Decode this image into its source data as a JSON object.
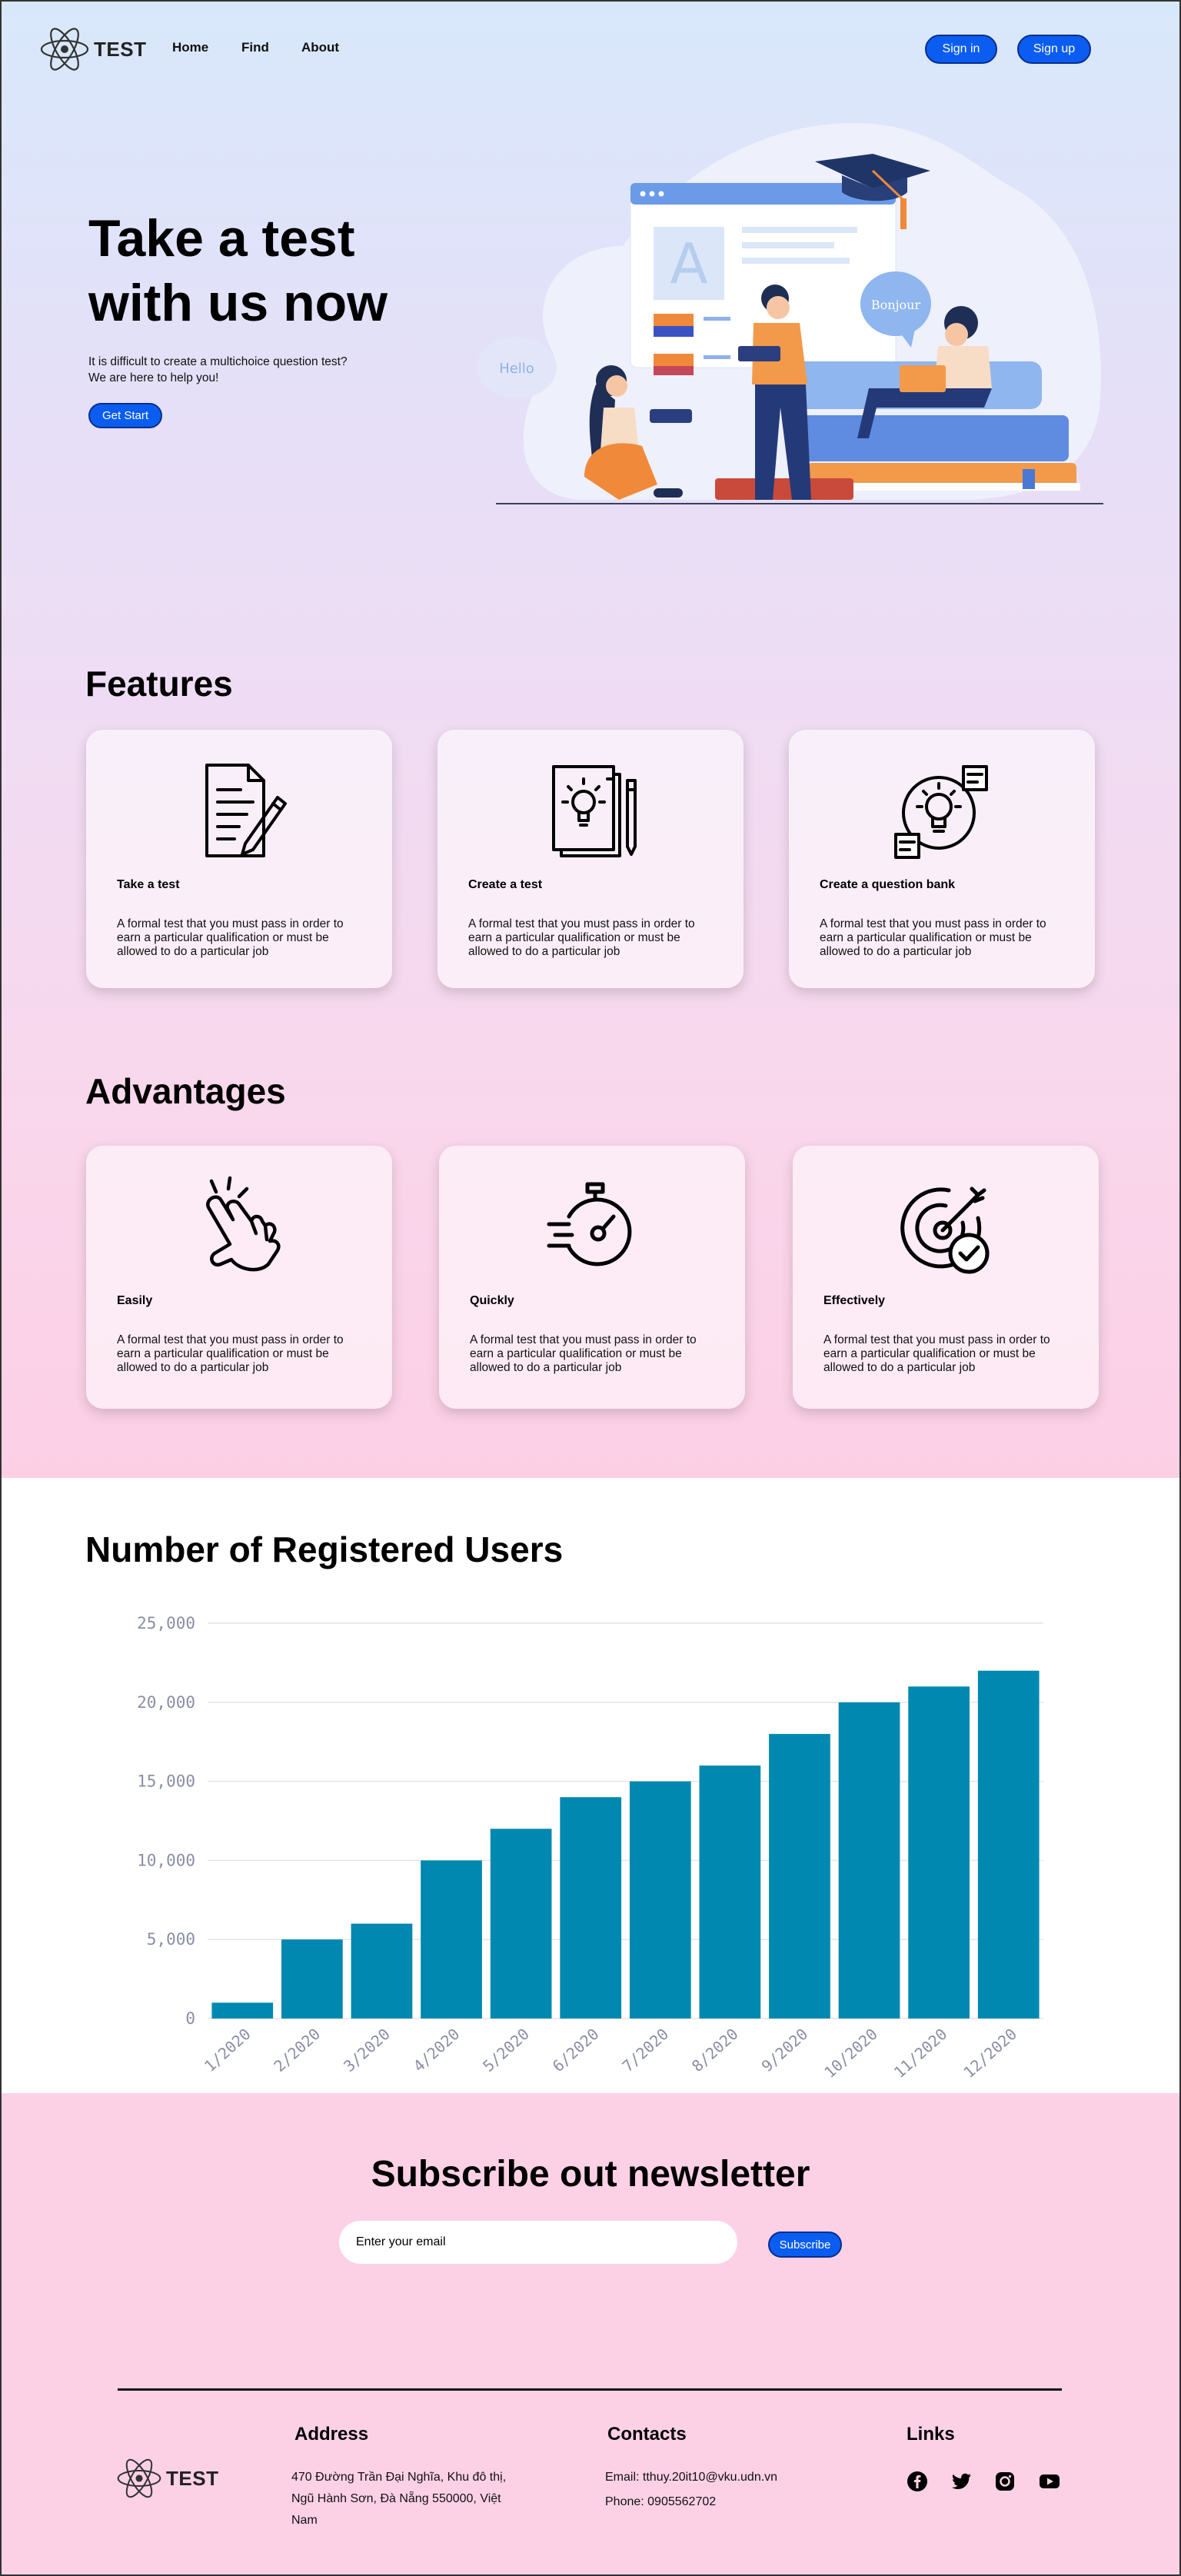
{
  "nav": {
    "brand": "TEST",
    "links": [
      "Home",
      "Find",
      "About"
    ],
    "sign_in": "Sign in",
    "sign_up": "Sign up"
  },
  "hero": {
    "title_line1": "Take a test",
    "title_line2": "with us now",
    "subtitle": "It is difficult to create a multichoice question test? We are here to help you!",
    "cta": "Get Start",
    "illustration": {
      "bubble_left": "Hello",
      "bubble_right": "Bonjour",
      "page_letter": "A"
    }
  },
  "features": {
    "title": "Features",
    "cards": [
      {
        "icon": "document-pen-icon",
        "title": "Take a test",
        "desc": "A formal test that you must pass in order to earn a particular qualification or must be allowed to do a particular job"
      },
      {
        "icon": "idea-papers-icon",
        "title": "Create a test",
        "desc": "A formal test that you must pass in order to earn a particular qualification or must be allowed to do a particular job"
      },
      {
        "icon": "lightbulb-bank-icon",
        "title": "Create a question bank",
        "desc": "A formal test that you must pass in order to earn a particular qualification or must be allowed to do a particular job"
      }
    ]
  },
  "advantages": {
    "title": "Advantages",
    "cards": [
      {
        "icon": "snap-fingers-icon",
        "title": "Easily",
        "desc": "A formal test that you must pass in order to earn a particular qualification or must be allowed to do a particular job"
      },
      {
        "icon": "stopwatch-icon",
        "title": "Quickly",
        "desc": "A formal test that you must pass in order to earn a particular qualification or must be allowed to do a particular job"
      },
      {
        "icon": "target-check-icon",
        "title": "Effectively",
        "desc": "A formal test that you must pass in order to earn a particular qualification or must be allowed to do a particular job"
      }
    ]
  },
  "chart_section": {
    "title": "Number of Registered Users"
  },
  "chart_data": {
    "type": "bar",
    "title": "Number of Registered Users",
    "categories": [
      "1/2020",
      "2/2020",
      "3/2020",
      "4/2020",
      "5/2020",
      "6/2020",
      "7/2020",
      "8/2020",
      "9/2020",
      "10/2020",
      "11/2020",
      "12/2020"
    ],
    "values": [
      1000,
      5000,
      6000,
      10000,
      12000,
      14000,
      15000,
      16000,
      18000,
      20000,
      21000,
      22000
    ],
    "ylim": [
      0,
      25000
    ],
    "yticks": [
      0,
      5000,
      10000,
      15000,
      20000,
      25000
    ],
    "ytick_labels": [
      "0",
      "5,000",
      "10,000",
      "15,000",
      "20,000",
      "25,000"
    ],
    "grid": true,
    "bar_color": "#0088b0",
    "xlabel": "",
    "ylabel": ""
  },
  "newsletter": {
    "title": "Subscribe out newsletter",
    "placeholder": "Enter your email",
    "button": "Subscribe"
  },
  "footer": {
    "brand": "TEST",
    "address_title": "Address",
    "address_lines": [
      "470 Đường Trần Đại Nghĩa, Khu đô thị,",
      "Ngũ Hành Sơn, Đà Nẵng 550000, Việt",
      "Nam"
    ],
    "contacts_title": "Contacts",
    "email": "Email: tthuy.20it10@vku.udn.vn",
    "phone": "Phone: 0905562702",
    "links_title": "Links",
    "socials": [
      "facebook-icon",
      "twitter-icon",
      "instagram-icon",
      "youtube-icon"
    ]
  },
  "colors": {
    "accent": "#0a5df0",
    "bar": "#0088b0",
    "pink_bg": "#fcd1e6"
  }
}
